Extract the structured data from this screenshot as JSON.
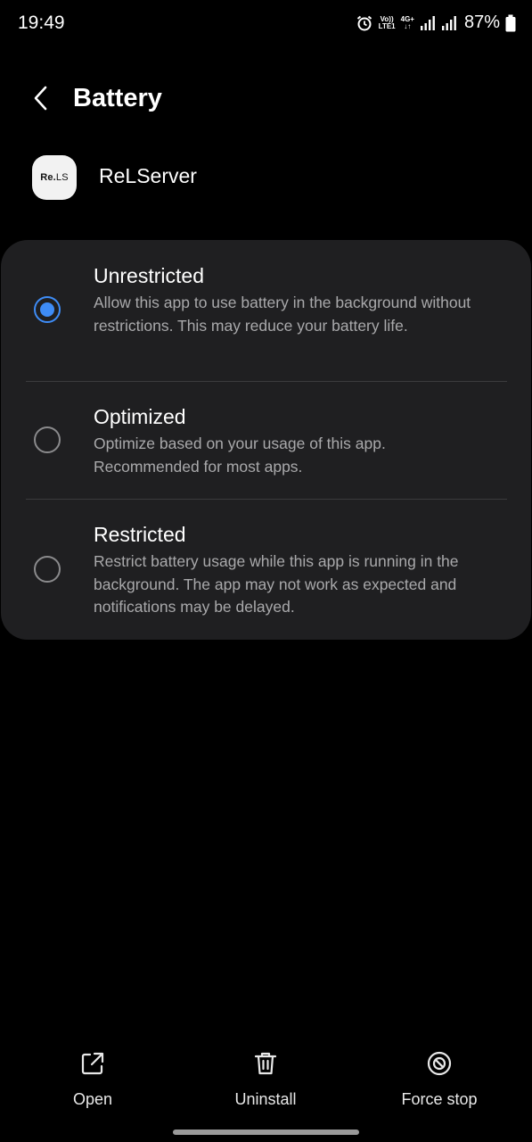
{
  "status_bar": {
    "time": "19:49",
    "volte_label_top": "Vo))",
    "volte_label_bottom": "LTE1",
    "network_type": "4G+",
    "battery_percent": "87%",
    "icons": [
      "alarm-icon",
      "volte-icon",
      "network-4g-icon",
      "signal-icon",
      "signal-icon",
      "battery-icon"
    ]
  },
  "header": {
    "title": "Battery",
    "back_icon": "chevron-left-icon"
  },
  "app": {
    "name": "ReLServer",
    "icon_text_bold": "Re.",
    "icon_text_regular": "LS"
  },
  "options": [
    {
      "title": "Unrestricted",
      "description": "Allow this app to use battery in the background without restrictions. This may reduce your battery life.",
      "selected": true
    },
    {
      "title": "Optimized",
      "description": "Optimize based on your usage of this app. Recommended for most apps.",
      "selected": false
    },
    {
      "title": "Restricted",
      "description": "Restrict battery usage while this app is running in the background. The app may not work as expected and notifications may be delayed.",
      "selected": false
    }
  ],
  "bottom_actions": [
    {
      "label": "Open",
      "icon": "open-external-icon"
    },
    {
      "label": "Uninstall",
      "icon": "trash-icon"
    },
    {
      "label": "Force stop",
      "icon": "force-stop-icon"
    }
  ],
  "colors": {
    "background": "#000000",
    "card": "#1f1f21",
    "accent": "#3e8cf6",
    "secondary_text": "#a9a9ab"
  }
}
